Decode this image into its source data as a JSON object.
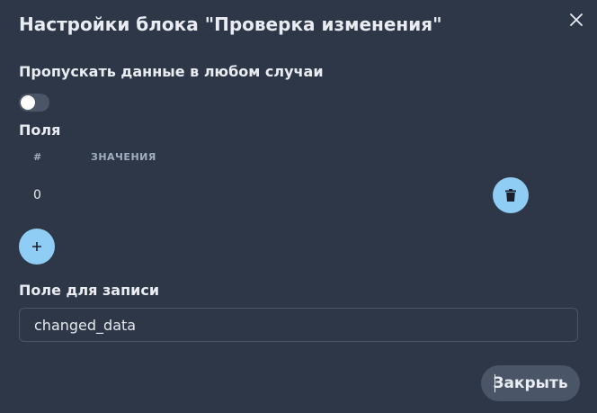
{
  "dialog": {
    "title": "Настройки блока \"Проверка изменения\"",
    "close_icon": "close-icon"
  },
  "skip_data": {
    "label": "Пропускать данные в любом случаи",
    "toggle_on": false
  },
  "fields": {
    "label": "Поля",
    "columns": [
      "#",
      "ЗНАЧЕНИЯ"
    ],
    "rows": [
      {
        "index": "0",
        "value": ""
      }
    ],
    "delete_icon": "trash-icon",
    "add_icon": "plus-icon"
  },
  "record_field": {
    "label": "Поле для записи",
    "value": "changed_data"
  },
  "footer": {
    "close_label": "Закрыть"
  },
  "colors": {
    "background": "#2d3748",
    "accent": "#90cdf4",
    "muted": "#4a5568"
  }
}
